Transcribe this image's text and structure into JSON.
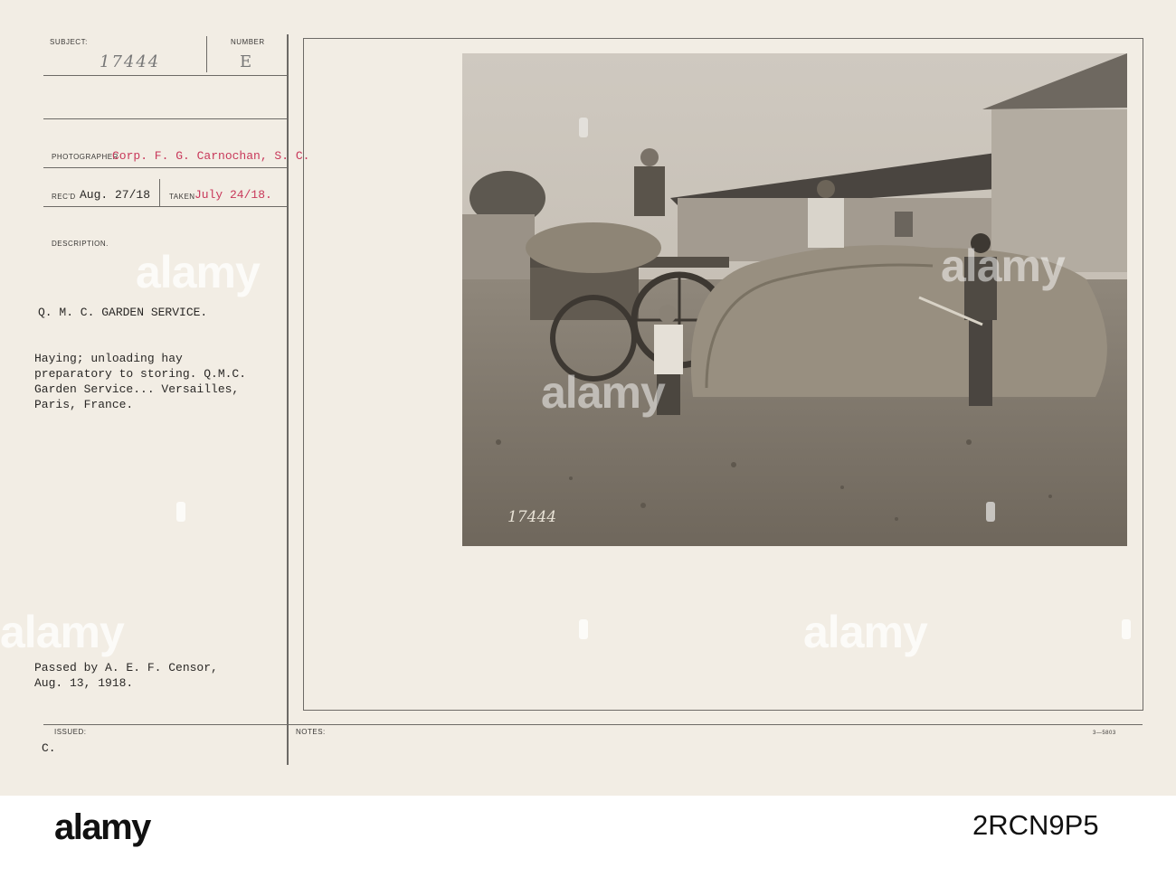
{
  "header": {
    "subject_label": "SUBJECT:",
    "subject_value": "17444",
    "number_label": "NUMBER",
    "number_value": "E"
  },
  "photographer": {
    "label": "PHOTOGRAPHER",
    "value": "Corp. F. G. Carnochan, S. C."
  },
  "dates": {
    "recd_label": "REC'D",
    "recd_value": "Aug. 27/18",
    "taken_label": "TAKEN",
    "taken_value": "July 24/18."
  },
  "description": {
    "label": "DESCRIPTION.",
    "title": "Q. M. C. GARDEN SERVICE.",
    "body": "Haying; unloading hay\npreparatory to storing. Q.M.C.\nGarden Service... Versailles,\nParis, France."
  },
  "censor": {
    "text": "Passed by A. E. F. Censor,\nAug. 13, 1918."
  },
  "issued": {
    "label": "ISSUED:",
    "value": "C."
  },
  "notes": {
    "label": "NOTES:",
    "form_number": "3—5803"
  },
  "photo": {
    "number": "17444"
  },
  "watermark": {
    "text": "alamy"
  },
  "footer": {
    "logo": "alamy",
    "image_id": "2RCN9P5"
  }
}
